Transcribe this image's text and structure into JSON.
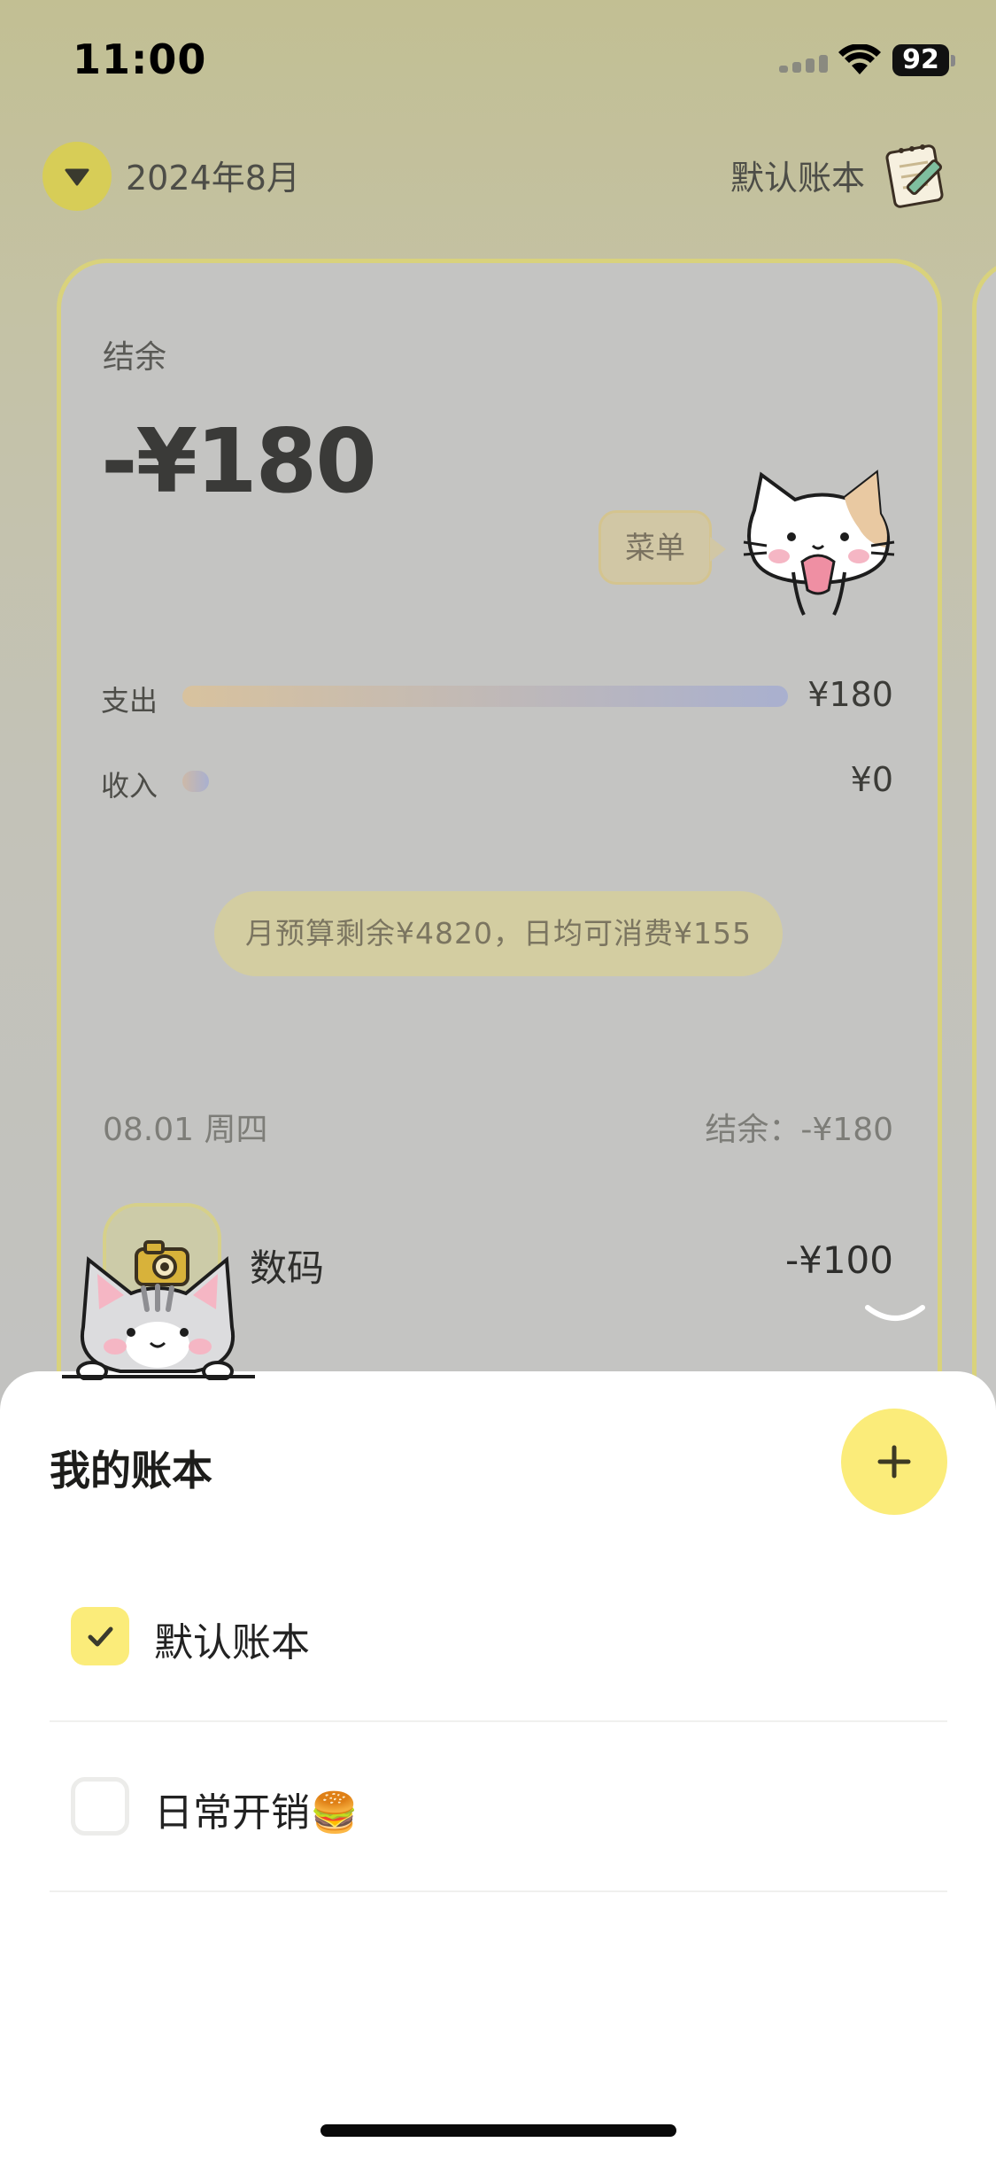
{
  "status_bar": {
    "time": "11:00",
    "battery": "92"
  },
  "header": {
    "month": "2024年8月",
    "book_name": "默认账本"
  },
  "summary": {
    "balance_label": "结余",
    "balance_value": "-¥180",
    "menu_bubble": "菜单",
    "expense_label": "支出",
    "expense_value": "¥180",
    "expense_fraction": 1.0,
    "income_label": "收入",
    "income_value": "¥0",
    "income_fraction": 0.0,
    "budget_text": "月预算剩余¥4820，日均可消费¥155"
  },
  "day": {
    "date": "08.01 周四",
    "balance": "结余：-¥180",
    "transactions": [
      {
        "icon": "camera-icon",
        "category": "数码",
        "amount": "-¥100"
      }
    ]
  },
  "sheet": {
    "title": "我的账本",
    "books": [
      {
        "name": "默认账本",
        "checked": true
      },
      {
        "name": "日常开销🍔",
        "checked": false
      }
    ]
  },
  "colors": {
    "accent": "#fbec7a",
    "card_border": "#d9d27c",
    "expense_bar_start": "#d8c29e",
    "expense_bar_end": "#a9b0cf"
  }
}
